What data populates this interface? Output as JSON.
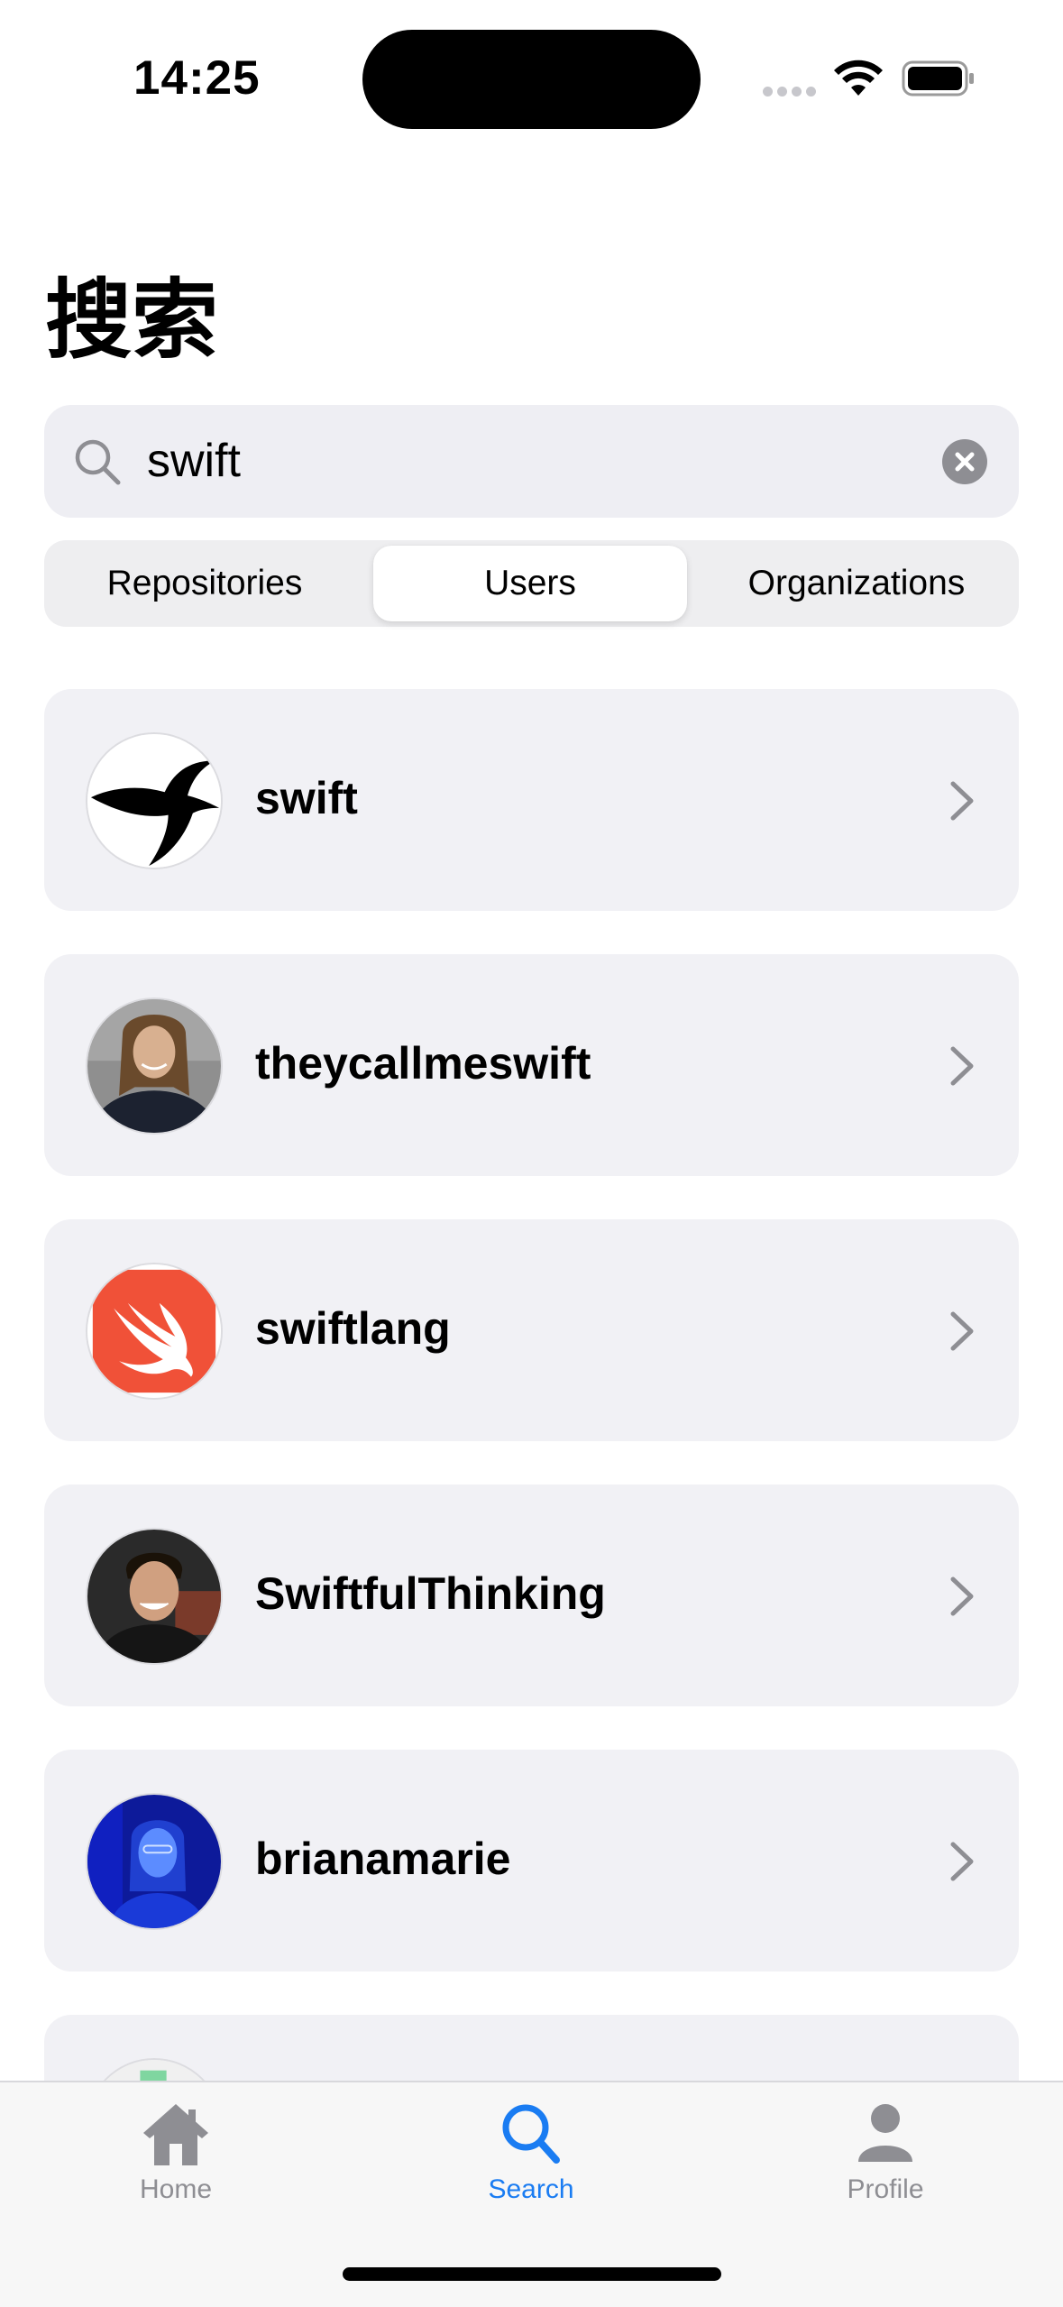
{
  "status_bar": {
    "time": "14:25"
  },
  "page": {
    "title": "搜索"
  },
  "search": {
    "value": "swift",
    "placeholder": ""
  },
  "segments": {
    "items": [
      {
        "label": "Repositories",
        "selected": false
      },
      {
        "label": "Users",
        "selected": true
      },
      {
        "label": "Organizations",
        "selected": false
      }
    ]
  },
  "users": [
    {
      "name": "swift",
      "avatar": "swallow-bird-logo"
    },
    {
      "name": "theycallmeswift",
      "avatar": "photo-man-long-hair"
    },
    {
      "name": "swiftlang",
      "avatar": "swift-language-logo"
    },
    {
      "name": "SwiftfulThinking",
      "avatar": "photo-man-smiling"
    },
    {
      "name": "brianamarie",
      "avatar": "photo-woman-blue-light"
    },
    {
      "name": "",
      "avatar": "identicon-partial"
    }
  ],
  "tab_bar": {
    "items": [
      {
        "label": "Home",
        "icon": "house-icon",
        "active": false
      },
      {
        "label": "Search",
        "icon": "magnifying-glass-icon",
        "active": true
      },
      {
        "label": "Profile",
        "icon": "person-icon",
        "active": false
      }
    ]
  },
  "colors": {
    "accent": "#1a7cf2",
    "inactive_tab": "#8e8e93",
    "card_background": "#f1f1f5",
    "swiftlang_logo": "#f05138"
  }
}
